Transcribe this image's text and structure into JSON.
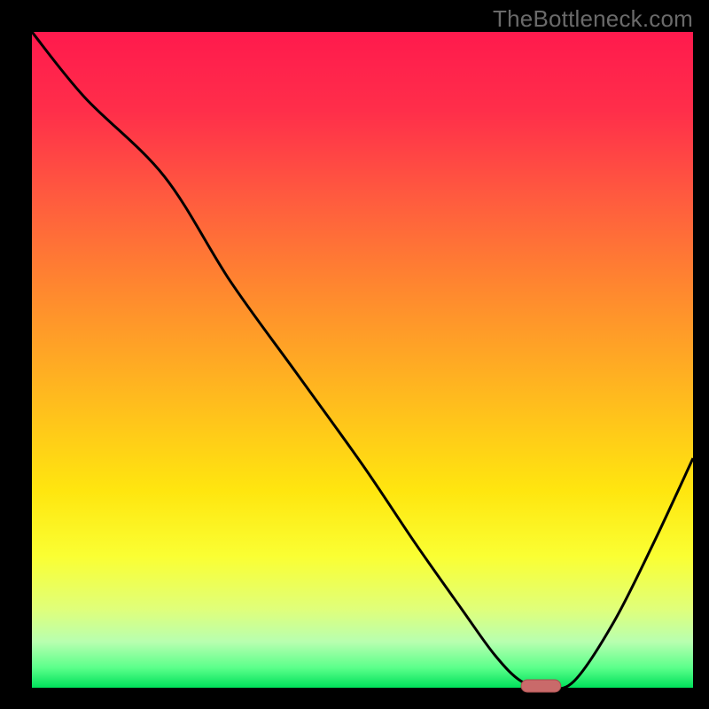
{
  "watermark": "TheBottleneck.com",
  "colors": {
    "background": "#000000",
    "gradient_stops": [
      {
        "offset": 0.0,
        "color": "#ff1a4d"
      },
      {
        "offset": 0.12,
        "color": "#ff2e4a"
      },
      {
        "offset": 0.25,
        "color": "#ff5a3f"
      },
      {
        "offset": 0.4,
        "color": "#ff8a2e"
      },
      {
        "offset": 0.55,
        "color": "#ffb81f"
      },
      {
        "offset": 0.7,
        "color": "#ffe60f"
      },
      {
        "offset": 0.8,
        "color": "#faff33"
      },
      {
        "offset": 0.88,
        "color": "#e0ff7a"
      },
      {
        "offset": 0.93,
        "color": "#b8ffb0"
      },
      {
        "offset": 0.97,
        "color": "#5aff8a"
      },
      {
        "offset": 1.0,
        "color": "#00e05a"
      }
    ],
    "curve": "#000000",
    "marker_fill": "#c96a6a",
    "marker_stroke": "#a54f4f"
  },
  "chart_data": {
    "type": "line",
    "title": "",
    "xlabel": "",
    "ylabel": "",
    "xlim": [
      0,
      100
    ],
    "ylim": [
      0,
      100
    ],
    "series": [
      {
        "name": "bottleneck-curve",
        "x": [
          0,
          8,
          20,
          30,
          40,
          50,
          58,
          65,
          70,
          74,
          78,
          82,
          88,
          94,
          100
        ],
        "y": [
          100,
          90,
          78,
          62,
          48,
          34,
          22,
          12,
          5,
          1,
          0,
          1,
          10,
          22,
          35
        ]
      }
    ],
    "marker": {
      "name": "optimal-range",
      "x_start": 74,
      "x_end": 80,
      "y": 0
    }
  }
}
